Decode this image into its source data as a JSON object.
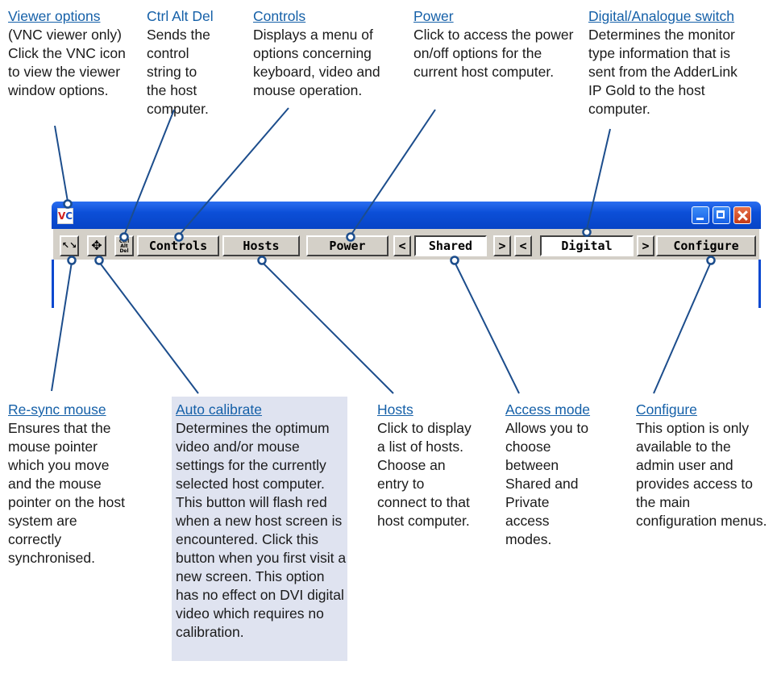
{
  "callouts": {
    "viewer_options": {
      "title": "Viewer options",
      "body": "(VNC viewer only) Click the VNC icon to view the viewer window options."
    },
    "ctrl_alt_del": {
      "title": "Ctrl Alt Del",
      "body": "Sends the control string to the host computer."
    },
    "controls": {
      "title": "Controls",
      "body": "Displays a menu of options concerning keyboard, video and mouse operation."
    },
    "power": {
      "title": "Power",
      "body": "Click to access the power on/off options for the current host computer."
    },
    "digital_switch": {
      "title": "Digital/Analogue switch",
      "body": "Determines the monitor type information that is sent from the AdderLink IP Gold to the host computer."
    },
    "resync_mouse": {
      "title": "Re-sync mouse",
      "body": "Ensures that the mouse pointer which you move and the mouse pointer on the host system are correctly synchronised."
    },
    "auto_calibrate": {
      "title": "Auto calibrate",
      "body": "Determines the optimum video and/or mouse settings for the currently selected host computer. This button will flash red when a new host screen is encountered. Click this button when you first visit a new screen. This option has no effect on DVI digital video which requires no calibration."
    },
    "hosts": {
      "title": "Hosts",
      "body": "Click to display a list of hosts. Choose an entry to connect to that host computer."
    },
    "access_mode": {
      "title": "Access mode",
      "body": "Allows you to choose between Shared and Private access modes."
    },
    "configure": {
      "title": "Configure",
      "body": "This option is only available to the admin user and provides access to the main configuration menus."
    }
  },
  "window": {
    "logo_v": "V",
    "logo_c": "C",
    "toolbar": {
      "resync_icon": "↖↘",
      "autocal_icon": "✥",
      "cad_label": "Ctrl Alt Del",
      "controls_label": "Controls",
      "hosts_label": "Hosts",
      "power_label": "Power",
      "prev_label": "<",
      "next_label": ">",
      "access_value": "Shared",
      "video_value": "Digital",
      "configure_label": "Configure"
    }
  },
  "colors": {
    "title_link": "#1560a8",
    "leader_line": "#1c4d8c",
    "highlight_bg": "#dfe3f0",
    "titlebar": "#0c4fd8"
  }
}
